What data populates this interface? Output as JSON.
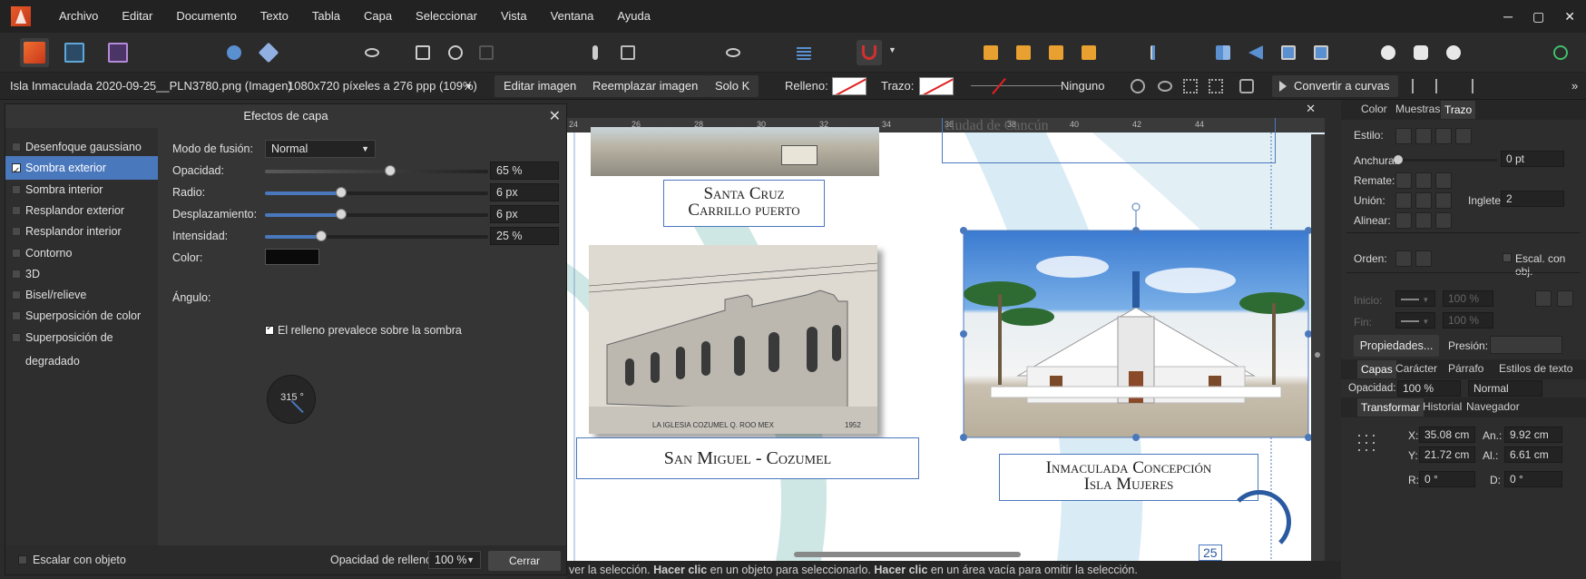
{
  "menubar": {
    "items": [
      "Archivo",
      "Editar",
      "Documento",
      "Texto",
      "Tabla",
      "Capa",
      "Seleccionar",
      "Vista",
      "Ventana",
      "Ayuda"
    ],
    "window_controls": [
      "─",
      "▢",
      "✕"
    ]
  },
  "contextbar": {
    "filename": "Isla Inmaculada 2020-09-25__PLN3780.png (Imagen)",
    "dimensions": "1080x720 píxeles a 276 ppp (109%)",
    "edit_image": "Editar imagen",
    "replace_image": "Reemplazar imagen",
    "only_k": "Solo K",
    "fill_label": "Relleno:",
    "stroke_label": "Trazo:",
    "stroke_none": "Ninguno",
    "convert_curves": "Convertir a curvas",
    "more": "»"
  },
  "dialog": {
    "title": "Efectos de capa",
    "close": "✕",
    "effects": [
      {
        "label": "Desenfoque gaussiano",
        "checked": false
      },
      {
        "label": "Sombra exterior",
        "checked": true
      },
      {
        "label": "Sombra interior",
        "checked": false
      },
      {
        "label": "Resplandor exterior",
        "checked": false
      },
      {
        "label": "Resplandor interior",
        "checked": false
      },
      {
        "label": "Contorno",
        "checked": false
      },
      {
        "label": "3D",
        "checked": false
      },
      {
        "label": "Bisel/relieve",
        "checked": false
      },
      {
        "label": "Superposición de color",
        "checked": false
      },
      {
        "label": "Superposición de degradado",
        "checked": false
      }
    ],
    "blend_label": "Modo de fusión:",
    "blend_value": "Normal",
    "opacity_label": "Opacidad:",
    "opacity_value": "65 %",
    "opacity_level": 0.56,
    "radius_label": "Radio:",
    "radius_value": "6 px",
    "radius_level": 0.34,
    "offset_label": "Desplazamiento:",
    "offset_value": "6 px",
    "offset_level": 0.34,
    "intensity_label": "Intensidad:",
    "intensity_value": "25 %",
    "intensity_level": 0.25,
    "color_label": "Color:",
    "shadow_color": "#0a0a0a",
    "angle_label": "Ángulo:",
    "angle_value": "315 °",
    "fill_prevails": "El relleno prevalece sobre la sombra",
    "fill_prevails_checked": true,
    "scale_with_object": "Escalar con objeto",
    "fill_opacity_label": "Opacidad de relleno:",
    "fill_opacity_value": "100 %",
    "close_button": "Cerrar"
  },
  "canvas": {
    "ruler_ticks": [
      "24",
      "26",
      "28",
      "30",
      "32",
      "34",
      "36",
      "38",
      "40",
      "42",
      "44"
    ],
    "top_text": "ciudad de Cancún",
    "captions": {
      "santa_cruz_1": "Santa Cruz",
      "santa_cruz_2": "Carrillo puerto",
      "san_miguel": "San Miguel - Cozumel",
      "inmaculada_1": "Inmaculada Concepción",
      "inmaculada_2": "Isla Mujeres"
    },
    "old_photo_caption": "LA IGLESIA  COZUMEL Q. ROO MEX",
    "old_photo_year": "1952",
    "page_number": "25"
  },
  "status": {
    "text_pre": "ver la selección. ",
    "bold1": "Hacer clic",
    "text_mid": " en un objeto para seleccionarlo. ",
    "bold2": "Hacer clic",
    "text_post": " en un área vacía para omitir la selección."
  },
  "stroke_panel": {
    "tabs": [
      "Color",
      "Muestras",
      "Trazo"
    ],
    "style_label": "Estilo:",
    "width_label": "Anchura:",
    "width_value": "0 pt",
    "cap_label": "Remate:",
    "join_label": "Unión:",
    "miter_label": "Inglete:",
    "miter_value": "2",
    "align_label": "Alinear:",
    "order_label": "Orden:",
    "scale_label": "Escal. con obj.",
    "start_label": "Inicio:",
    "end_label": "Fin:",
    "start_pct": "100 %",
    "end_pct": "100 %",
    "properties_button": "Propiedades...",
    "pressure_label": "Presión:"
  },
  "layers_panel": {
    "tabs": [
      "Capas",
      "Carácter",
      "Párrafo",
      "Estilos de texto"
    ],
    "opacity_label": "Opacidad:",
    "opacity_value": "100 %",
    "blend_value": "Normal"
  },
  "transform_panel": {
    "tabs": [
      "Transformar",
      "Historial",
      "Navegador"
    ],
    "x_label": "X:",
    "x_value": "35.08 cm",
    "y_label": "Y:",
    "y_value": "21.72 cm",
    "w_label": "An.:",
    "w_value": "9.92 cm",
    "h_label": "Al.:",
    "h_value": "6.61 cm",
    "r_label": "R:",
    "r_value": "0 °",
    "s_label": "D:",
    "s_value": "0 °"
  },
  "colors": {
    "accent": "#4a78bd",
    "logo": "#e75a2a"
  }
}
